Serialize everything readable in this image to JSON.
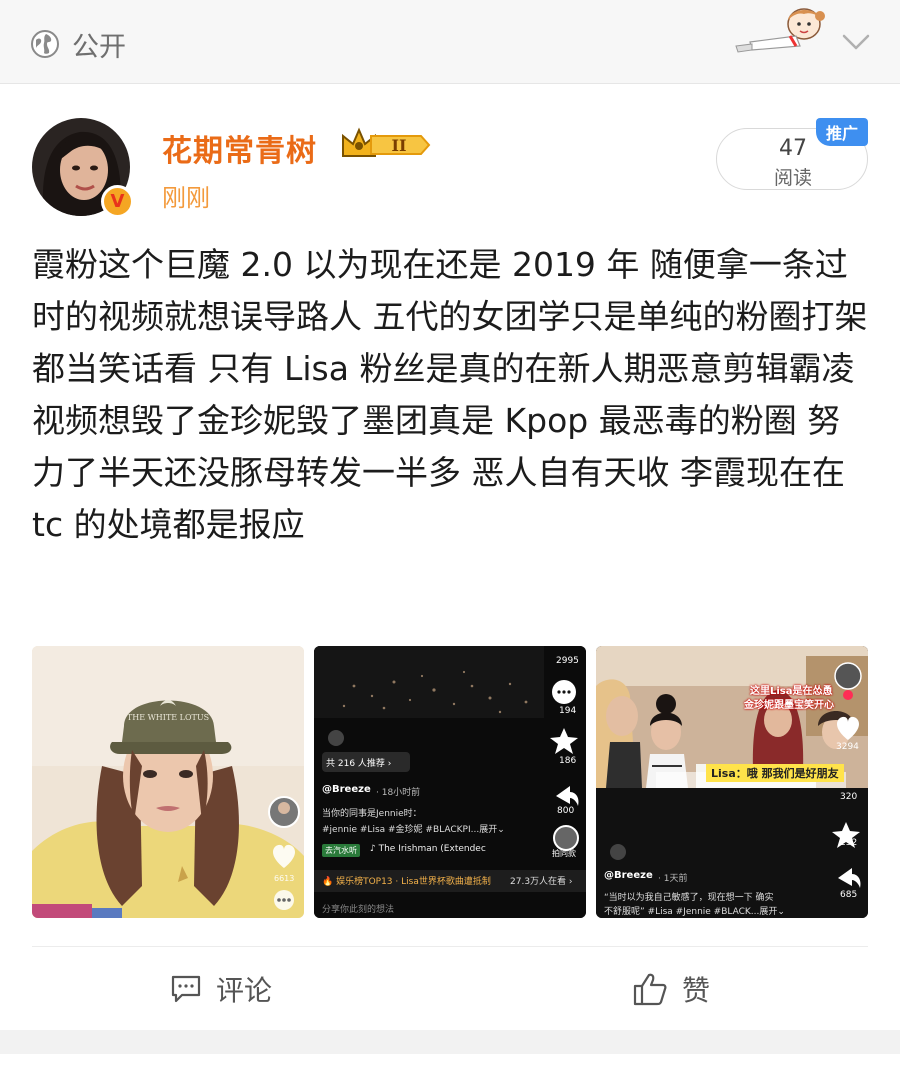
{
  "header": {
    "privacy_label": "公开",
    "globe_icon": "globe-icon",
    "menu_icon": "chevron-down-icon"
  },
  "post": {
    "username": "花期常青树",
    "member_level": "II",
    "timestamp": "刚刚",
    "reads_count": "47",
    "reads_label": "阅读",
    "promo_label": "推广",
    "text": "霞粉这个巨魔 2.0 以为现在还是 2019 年 随便拿一条过时的视频就想误导路人 五代的女团学只是单纯的粉圈打架都当笑话看 只有 Lisa 粉丝是真的在新人期恶意剪辑霸凌视频想毁了金珍妮毁了墨团真是 Kpop 最恶毒的粉圈 努力了半天还没豚母转发一半多 恶人自有天收 李霞现在在 tc 的处境都是报应"
  },
  "media": [
    {
      "hat_text": "THE WHITE LOTUS",
      "like_count": "6613"
    },
    {
      "top_count": "2995",
      "comment_count": "194",
      "star_count": "186",
      "share_count": "800",
      "recommend": "共 216 人推荐 ›",
      "author": "@Breeze",
      "time": "· 18小时前",
      "caption1": "当你的同事是Jennie时：",
      "caption2": "#jennie #Lisa #金珍妮 #BLACKPI...展开⌄",
      "music_tag": "去汽水听",
      "music": "♪ The Irishman (Extendec",
      "same_style": "拍同款",
      "banner": "🔥 娱乐榜TOP13 · Lisa世界杯歌曲遭抵制",
      "banner_count": "27.3万人在看 ›",
      "comment_placeholder": "分享你此刻的想法"
    },
    {
      "overlay_title": "这里Lisa是在怂恿",
      "overlay_sub": "金珍妮跟墨宝笑开心",
      "subtitle": "Lisa：哦 那我们是好朋友",
      "like_count": "3294",
      "comment_count": "320",
      "star_count": "232",
      "share_count": "685",
      "author": "@Breeze",
      "time": "· 1天前",
      "caption1": "“当时以为我自己敏感了，现在想一下 确实",
      "caption2": "不舒服呢” #Lisa #Jennie #BLACK...展开⌄"
    }
  ],
  "actions": {
    "comment_label": "评论",
    "like_label": "赞"
  },
  "colors": {
    "username": "#ea6b17",
    "timestamp": "#f39a3c",
    "promo_badge": "#3e8ff0",
    "verified_badge": "#f5a623"
  }
}
